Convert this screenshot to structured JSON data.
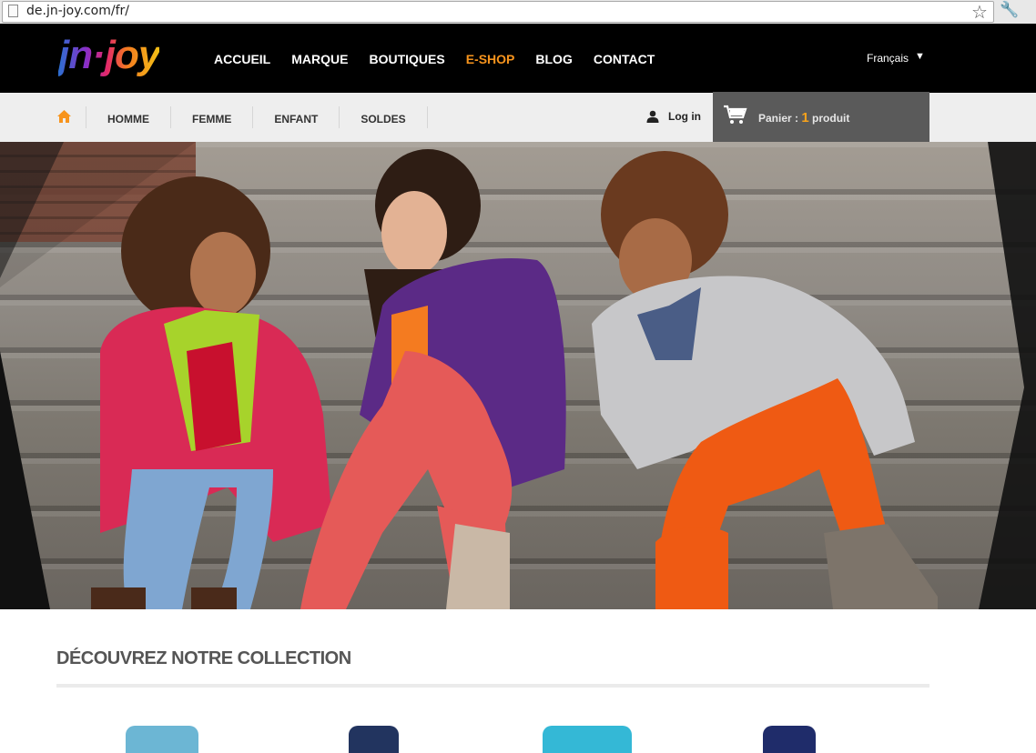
{
  "browser": {
    "url": "de.jn-joy.com/fr/"
  },
  "brand": {
    "logo_text": "jn·joy"
  },
  "main_nav": {
    "items": [
      {
        "label": "ACCUEIL",
        "active": false
      },
      {
        "label": "MARQUE",
        "active": false
      },
      {
        "label": "BOUTIQUES",
        "active": false
      },
      {
        "label": "E-SHOP",
        "active": true
      },
      {
        "label": "BLOG",
        "active": false
      },
      {
        "label": "CONTACT",
        "active": false
      }
    ],
    "language": "Français"
  },
  "sub_nav": {
    "items": [
      "HOMME",
      "FEMME",
      "ENFANT",
      "SOLDES"
    ],
    "login_label": "Log in"
  },
  "cart": {
    "label": "Panier :",
    "count": "1",
    "unit": "produit"
  },
  "hero": {
    "slide_count": 3
  },
  "collection": {
    "title": "DÉCOUVREZ NOTRE COLLECTION"
  },
  "colors": {
    "accent": "#f7941d",
    "header_bg": "#000000",
    "subnav_bg": "#eeeeee",
    "cart_bg": "#5a5a5a"
  }
}
